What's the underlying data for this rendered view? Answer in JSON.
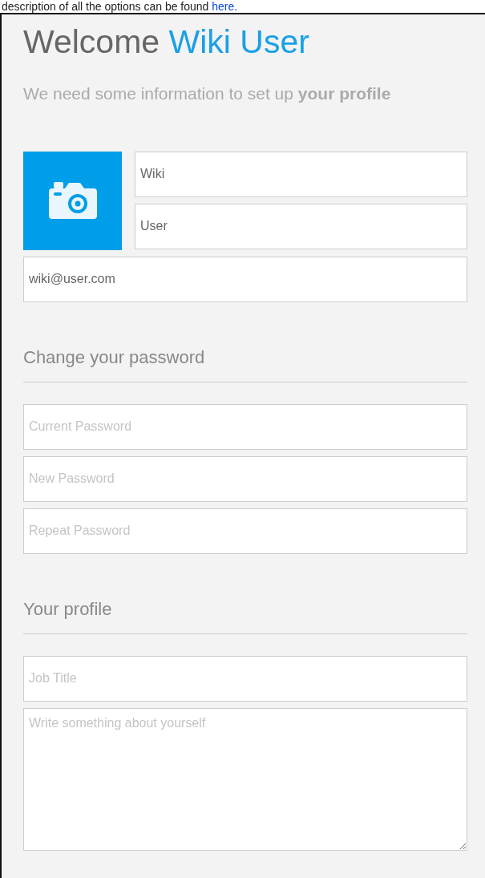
{
  "intro": {
    "text": "description of all the options can be found",
    "link": "here",
    "end": "."
  },
  "heading": {
    "text": "Welcome",
    "highlight": "Wiki User"
  },
  "subtitle": "We need some information to set up **your profile**",
  "identity": {
    "first_name": "Wiki",
    "last_name": "User",
    "email": "wiki@user.com"
  },
  "sections": [
    {
      "title": "Change your password",
      "fields": [
        {
          "kind": "input",
          "placeholder": "Current Password"
        },
        {
          "kind": "input",
          "placeholder": "New Password"
        },
        {
          "kind": "input",
          "placeholder": "Repeat Password"
        }
      ]
    },
    {
      "title": "Your profile",
      "fields": [
        {
          "kind": "input",
          "placeholder": "Job Title"
        },
        {
          "kind": "textarea",
          "placeholder": "Write something about yourself"
        }
      ]
    }
  ]
}
